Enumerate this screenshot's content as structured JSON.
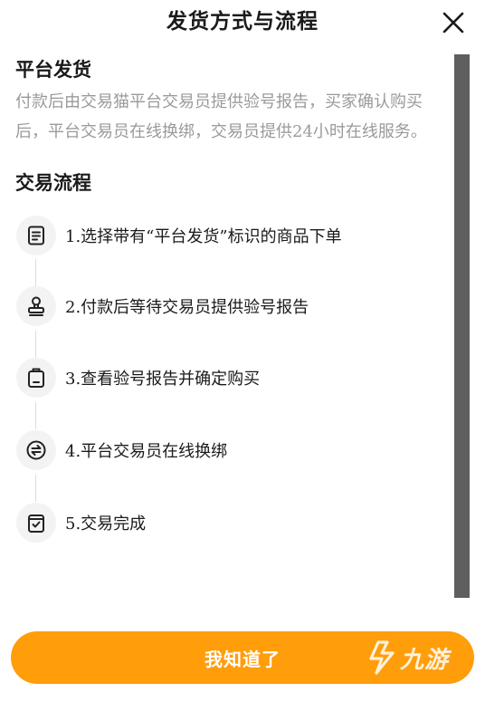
{
  "dialog": {
    "title": "发货方式与流程",
    "close_icon": "close-icon"
  },
  "platform_shipping": {
    "heading": "平台发货",
    "desc_line1": "付款后由交易猫平台交易员提供验号报告，买家确认购买",
    "desc_line2": "后，平台交易员在线换绑，交易员提供24小时在线服务。"
  },
  "trade_process": {
    "heading": "交易流程",
    "steps": [
      {
        "icon": "document-list-icon",
        "label": "1.选择带有“平台发货”标识的商品下单"
      },
      {
        "icon": "stamp-icon",
        "label": "2.付款后等待交易员提供验号报告"
      },
      {
        "icon": "clipboard-icon",
        "label": "3.查看验号报告并确定购买"
      },
      {
        "icon": "swap-arrows-icon",
        "label": "4.平台交易员在线换绑"
      },
      {
        "icon": "check-box-icon",
        "label": "5.交易完成"
      }
    ]
  },
  "confirm": {
    "label": "我知道了"
  },
  "watermark": {
    "text": "九游",
    "icon": "jiuyou-logo-icon"
  },
  "colors": {
    "accent": "#ff9d0a",
    "scrollbar": "#5f5f5f",
    "muted_text": "#9a9a9a"
  }
}
